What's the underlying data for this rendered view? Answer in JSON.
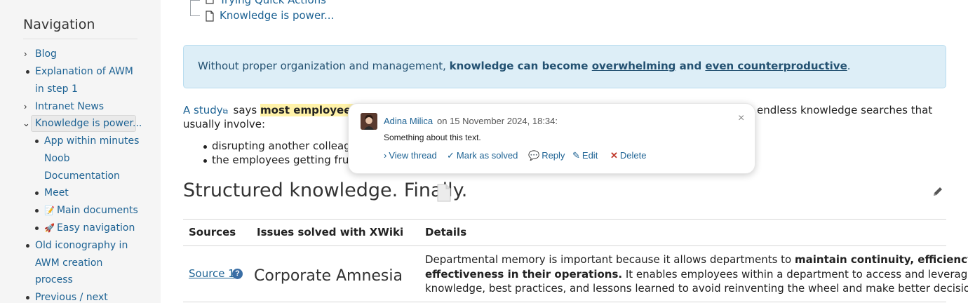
{
  "sidebar": {
    "title": "Navigation",
    "items": [
      {
        "label": "Blog"
      },
      {
        "label_line1": "Explanation of AWM",
        "label_line2": "in step 1"
      },
      {
        "label": "Intranet News"
      },
      {
        "label": "Knowledge is power..."
      },
      {
        "label": "App within minutes"
      },
      {
        "label_line1": "Noob",
        "label_line2": "Documentation"
      },
      {
        "label": "Meet"
      },
      {
        "label": "Main documents",
        "emoji": "📝"
      },
      {
        "label": "Easy navigation",
        "emoji": "🚀"
      },
      {
        "label_line1": "Old iconography in",
        "label_line2": "AWM creation",
        "label_line3": "process"
      },
      {
        "label": "Previous / next"
      }
    ]
  },
  "tree": {
    "prev_label": "Trying Quick Actions",
    "current_label": "Knowledge is power..."
  },
  "info_box": {
    "part1": "Without proper organization and management, ",
    "bold1": "knowledge can become ",
    "link1": "overwhelming",
    "bold2": " and ",
    "link2": "even counterproductive",
    "end": "."
  },
  "paragraph": {
    "link": "A study",
    "says": " says ",
    "highlight": "most employees us",
    "tail": "endless knowledge searches that",
    "line2": "usually involve:",
    "bullets": [
      "disrupting another colleague",
      "the employees getting frustra"
    ]
  },
  "section": {
    "heading": "Structured knowledge. Finally."
  },
  "table": {
    "headers": [
      "Sources",
      "Issues solved with XWiki",
      "Details"
    ],
    "row": {
      "source": "Source 1",
      "help": "?",
      "issue": "Corporate Amnesia",
      "detail_line1_a": "Departmental memory is important because it allows departments to ",
      "detail_line1_b": "maintain continuity, efficiency, and",
      "detail_line2_a": "effectiveness in their operations.",
      "detail_line2_b": " It enables employees within a department to access and leverage past",
      "detail_line3": "knowledge, best practices, and lessons learned to avoid reinventing the wheel and make better decisions."
    }
  },
  "comment_popup": {
    "author": "Adina Milica",
    "date": "on 15 November 2024, 18:34:",
    "text": "Something about this text.",
    "close": "×",
    "actions": {
      "view_thread": "View thread",
      "mark_solved": "Mark as solved",
      "reply": "Reply",
      "edit": "Edit",
      "delete": "Delete"
    }
  },
  "colors": {
    "link": "#1e6394",
    "info_bg": "#ddeef7",
    "highlight": "#fff2a8",
    "delete_icon": "#c0392b"
  }
}
